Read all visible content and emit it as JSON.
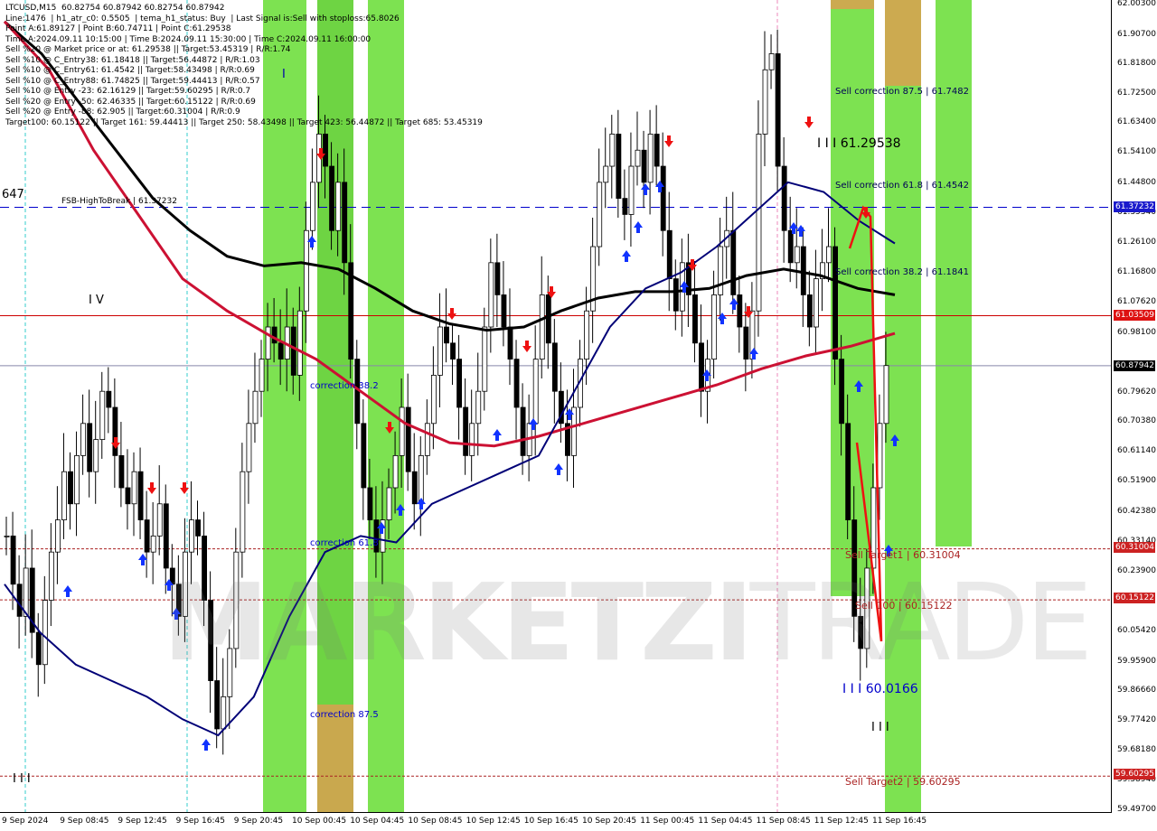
{
  "info_lines": [
    "LTCUSD,M15  60.82754 60.87942 60.82754 60.87942",
    "Line:1476  | h1_atr_c0: 0.5505  | tema_h1_status: Buy  | Last Signal is:Sell with stoploss:65.8026",
    "Point A:61.89127 | Point B:60.74711 | Point C:61.29538",
    "Time A:2024.09.11 10:15:00 | Time B:2024.09.11 15:30:00 | Time C:2024.09.11 16:00:00",
    "Sell %20 @ Market price or at: 61.29538 || Target:53.45319 | R/R:1.74",
    "Sell %10 @ C_Entry38: 61.18418 || Target:56.44872 | R/R:1.03",
    "Sell %10 @ C_Entry61: 61.4542 || Target:58.43498 | R/R:0.69",
    "Sell %10 @ C_Entry88: 61.74825 || Target:59.44413 | R/R:0.57",
    "Sell %10 @ Entry -23: 62.16129 || Target:59.60295 | R/R:0.7",
    "Sell %20 @ Entry -50: 62.46335 || Target:60.15122 | R/R:0.69",
    "Sell %20 @ Entry -88: 62.905 || Target:60.31004 | R/R:0.9",
    "Target100: 60.15122 || Target 161: 59.44413 || Target 250: 58.43498 || Target 423: 56.44872 || Target 685: 53.45319"
  ],
  "price_axis": [
    "62.00300",
    "61.90700",
    "61.81800",
    "61.72500",
    "61.63400",
    "61.54100",
    "61.44800",
    "61.35340",
    "61.26100",
    "61.16800",
    "61.07620",
    "60.98100",
    "60.79620",
    "60.70380",
    "60.61140",
    "60.51900",
    "60.42380",
    "60.33140",
    "60.23900",
    "60.05420",
    "59.95900",
    "59.86660",
    "59.77420",
    "59.68180",
    "59.58940",
    "59.49700"
  ],
  "time_axis": [
    "9 Sep 2024",
    "9 Sep 08:45",
    "9 Sep 12:45",
    "9 Sep 16:45",
    "9 Sep 20:45",
    "10 Sep 00:45",
    "10 Sep 04:45",
    "10 Sep 08:45",
    "10 Sep 12:45",
    "10 Sep 16:45",
    "10 Sep 20:45",
    "11 Sep 00:45",
    "11 Sep 04:45",
    "11 Sep 08:45",
    "11 Sep 12:45",
    "11 Sep 16:45"
  ],
  "price_tags": {
    "fsb": "61.37232",
    "red_line": "61.03509",
    "current": "60.87942",
    "target1": "60.31004",
    "target100": "60.15122",
    "target2": "59.60295"
  },
  "labels": {
    "fsb_left": "647",
    "fsb_high": "FSB-HighToBreak | 61.37232",
    "iv": "I V",
    "correction_38": "correction 38.2",
    "correction_61": "correction 61.8",
    "correction_87": "correction 87.5",
    "sell_corr_875": "Sell correction 87.5 | 61.7482",
    "sell_corr_618": "Sell correction 61.8 | 61.4542",
    "sell_corr_382": "Sell correction 38.2 | 61.1841",
    "point_c": "I I I 61.29538",
    "point_b": "I I I 60.0166",
    "sell_target1": "Sell Target1 | 60.31004",
    "sell_target100": "Sell 100 | 60.15122",
    "sell_target2": "Sell Target2 | 59.60295",
    "iii_bottom": "I I I",
    "iii_left": "I I I",
    "i_mark": "I"
  },
  "watermark": {
    "bold": "MARKETZI",
    "thin": "TRADE"
  },
  "chart_data": {
    "type": "candlestick",
    "symbol": "LTCUSD",
    "timeframe": "M15",
    "ohlc_last": {
      "open": 60.82754,
      "high": 60.87942,
      "low": 60.82754,
      "close": 60.87942
    },
    "ylim": [
      59.497,
      62.003
    ],
    "x_ticks": [
      "9 Sep 2024",
      "9 Sep 08:45",
      "9 Sep 12:45",
      "9 Sep 16:45",
      "9 Sep 20:45",
      "10 Sep 00:45",
      "10 Sep 04:45",
      "10 Sep 08:45",
      "10 Sep 12:45",
      "10 Sep 16:45",
      "10 Sep 20:45",
      "11 Sep 00:45",
      "11 Sep 04:45",
      "11 Sep 08:45",
      "11 Sep 12:45",
      "11 Sep 16:45"
    ],
    "horizontal_levels": [
      {
        "name": "FSB-HighToBreak",
        "value": 61.37232,
        "color": "#0000cc",
        "style": "dashed"
      },
      {
        "value": 61.03509,
        "color": "#cc0000",
        "style": "solid"
      },
      {
        "value": 60.87942,
        "color": "#8888aa",
        "style": "solid"
      },
      {
        "name": "Sell Target1",
        "value": 60.31004,
        "color": "#aa2222",
        "style": "dotted"
      },
      {
        "name": "Sell 100",
        "value": 60.15122,
        "color": "#aa2222",
        "style": "dotted"
      },
      {
        "name": "Sell Target2",
        "value": 59.60295,
        "color": "#aa2222",
        "style": "dotted"
      }
    ],
    "closes": [
      60.35,
      60.2,
      60.1,
      60.25,
      60.05,
      59.95,
      60.15,
      60.3,
      60.4,
      60.55,
      60.45,
      60.6,
      60.7,
      60.55,
      60.65,
      60.8,
      60.75,
      60.6,
      60.5,
      60.45,
      60.55,
      60.4,
      60.3,
      60.35,
      60.45,
      60.25,
      60.2,
      60.1,
      60.3,
      60.4,
      60.35,
      60.15,
      59.9,
      59.75,
      59.85,
      60.0,
      60.3,
      60.55,
      60.7,
      60.8,
      60.9,
      61.0,
      60.95,
      60.9,
      61.0,
      60.85,
      61.05,
      61.3,
      61.45,
      61.6,
      61.5,
      61.3,
      61.45,
      61.2,
      60.9,
      60.7,
      60.5,
      60.4,
      60.3,
      60.4,
      60.5,
      60.6,
      60.75,
      60.55,
      60.45,
      60.6,
      60.7,
      60.85,
      61.0,
      60.95,
      60.9,
      60.75,
      60.6,
      60.7,
      60.8,
      61.0,
      61.2,
      61.1,
      61.0,
      60.9,
      60.75,
      60.6,
      60.7,
      60.9,
      61.1,
      60.95,
      60.8,
      60.7,
      60.6,
      60.75,
      60.9,
      61.05,
      61.25,
      61.45,
      61.5,
      61.6,
      61.4,
      61.35,
      61.5,
      61.55,
      61.45,
      61.6,
      61.5,
      61.3,
      61.15,
      61.05,
      61.2,
      61.1,
      60.95,
      60.8,
      60.9,
      61.1,
      61.25,
      61.3,
      61.1,
      61.0,
      60.9,
      61.05,
      61.6,
      61.8,
      61.85,
      61.5,
      61.3,
      61.2,
      61.25,
      61.1,
      61.0,
      61.15,
      61.2,
      61.25,
      60.9,
      60.7,
      60.4,
      60.1,
      60.0,
      60.25,
      60.5,
      60.7,
      60.88
    ],
    "moving_averages": [
      {
        "color": "#000000",
        "values": [
          61.95,
          61.85,
          61.7,
          61.55,
          61.4,
          61.3,
          61.22,
          61.19,
          61.2,
          61.18,
          61.12,
          61.05,
          61.01,
          60.99,
          61.0,
          61.05,
          61.09,
          61.11,
          61.11,
          61.12,
          61.16,
          61.18,
          61.16,
          61.12,
          61.1
        ]
      },
      {
        "color": "#cc1133",
        "values": [
          61.95,
          61.8,
          61.55,
          61.35,
          61.15,
          61.05,
          60.97,
          60.9,
          60.8,
          60.7,
          60.64,
          60.63,
          60.66,
          60.7,
          60.74,
          60.78,
          60.82,
          60.87,
          60.91,
          60.94,
          60.98
        ]
      },
      {
        "color": "#000077",
        "values": [
          60.2,
          60.05,
          59.95,
          59.9,
          59.85,
          59.78,
          59.73,
          59.85,
          60.1,
          60.3,
          60.35,
          60.33,
          60.45,
          60.5,
          60.55,
          60.6,
          60.8,
          61.0,
          61.12,
          61.17,
          61.25,
          61.35,
          61.45,
          61.42,
          61.33,
          61.26
        ]
      }
    ]
  }
}
